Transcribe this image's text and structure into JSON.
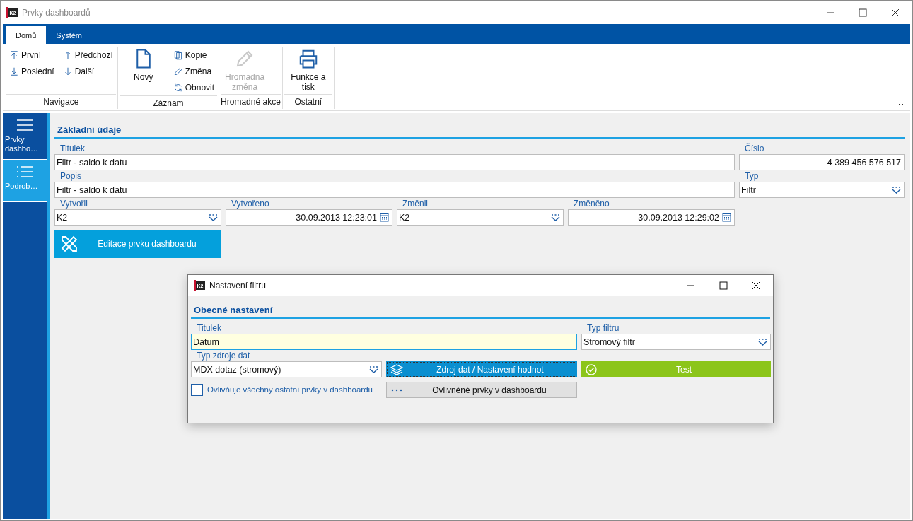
{
  "window": {
    "logo": "K2",
    "title": "Prvky dashboardů"
  },
  "ribbon": {
    "tabs": [
      {
        "label": "Domů",
        "selected": true
      },
      {
        "label": "Systém",
        "selected": false
      }
    ],
    "groups": [
      {
        "label": "Navigace",
        "columns": [
          [
            {
              "label": "První",
              "kind": "small",
              "disabled": false
            },
            {
              "label": "Poslední",
              "kind": "small",
              "disabled": false
            }
          ],
          [
            {
              "label": "Předchozí",
              "kind": "small",
              "disabled": false
            },
            {
              "label": "Další",
              "kind": "small",
              "disabled": false
            }
          ]
        ]
      },
      {
        "label": "Záznam",
        "columns": [
          [
            {
              "label": "Nový",
              "kind": "large",
              "disabled": false
            }
          ],
          [
            {
              "label": "Kopie",
              "kind": "small",
              "disabled": false
            },
            {
              "label": "Změna",
              "kind": "small",
              "disabled": false
            },
            {
              "label": "Obnovit",
              "kind": "small",
              "disabled": false
            }
          ]
        ]
      },
      {
        "label": "Hromadné akce",
        "columns": [
          [
            {
              "label": "Hromadná změna",
              "kind": "large",
              "disabled": true
            }
          ]
        ]
      },
      {
        "label": "Ostatní",
        "columns": [
          [
            {
              "label": "Funkce a tisk",
              "kind": "large",
              "disabled": false
            }
          ]
        ]
      }
    ]
  },
  "sidebar": {
    "items": [
      {
        "label": "Prvky dashbo…",
        "selected": false
      },
      {
        "label": "Podrob…",
        "selected": true
      }
    ]
  },
  "form": {
    "section": "Základní údaje",
    "rows": [
      [
        {
          "label": "Titulek",
          "value": "Filtr - saldo k datu",
          "kind": "text"
        },
        {
          "label": "Číslo",
          "value": "4 389 456 576 517",
          "kind": "number"
        }
      ],
      [
        {
          "label": "Popis",
          "value": "Filtr - saldo k datu",
          "kind": "text"
        },
        {
          "label": "Typ",
          "value": "Filtr",
          "kind": "combo"
        }
      ],
      [
        {
          "label": "Vytvořil",
          "value": "K2",
          "kind": "combo"
        },
        {
          "label": "Vytvořeno",
          "value": "30.09.2013 12:23:01",
          "kind": "date"
        },
        {
          "label": "Změnil",
          "value": "K2",
          "kind": "combo"
        },
        {
          "label": "Změněno",
          "value": "30.09.2013 12:29:02",
          "kind": "date"
        }
      ]
    ],
    "button": "Editace prvku dashboardu"
  },
  "dialog": {
    "logo": "K2",
    "title": "Nastavení filtru",
    "section": "Obecné nastavení",
    "fields": [
      {
        "label": "Titulek",
        "value": "Datum",
        "kind": "text",
        "focused": true
      },
      {
        "label": "Typ filtru",
        "value": "Stromový filtr",
        "kind": "combo",
        "focused": false
      },
      {
        "label": "Typ zdroje dat",
        "value": "MDX dotaz (stromový)",
        "kind": "combo",
        "focused": false
      }
    ],
    "buttons": [
      {
        "label": "Zdroj dat / Nastavení hodnot",
        "kind": "primary"
      },
      {
        "label": "Test",
        "kind": "success"
      },
      {
        "label": "Ovlivněné prvky v dashboardu",
        "kind": "plain"
      }
    ],
    "checkbox": {
      "label": "Ovlivňuje všechny ostatní prvky v dashboardu",
      "checked": false
    }
  }
}
